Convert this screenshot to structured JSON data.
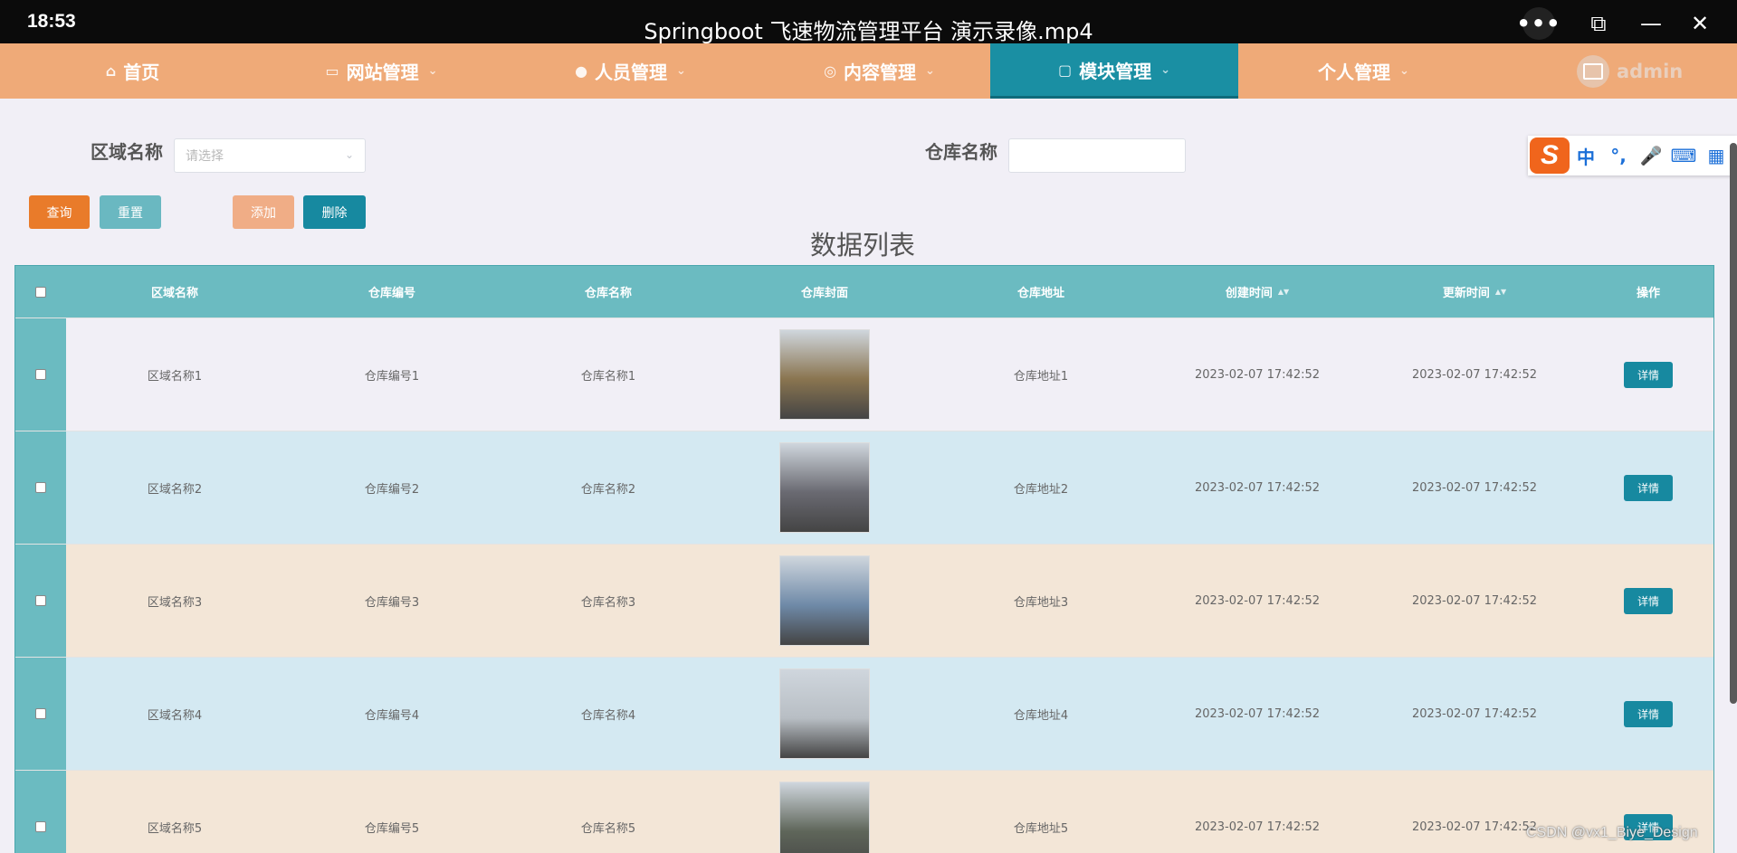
{
  "player": {
    "time": "18:53",
    "title": "Springboot 飞速物流管理平台 演示录像.mp4",
    "more": "•••",
    "pip": "⧉",
    "minimize": "—",
    "close": "✕"
  },
  "nav": {
    "items": [
      {
        "label": "首页",
        "icon": "home-icon",
        "glyph": "⌂"
      },
      {
        "label": "网站管理",
        "icon": "monitor-icon",
        "glyph": "▭"
      },
      {
        "label": "人员管理",
        "icon": "user-icon",
        "glyph": "●"
      },
      {
        "label": "内容管理",
        "icon": "circle-icon",
        "glyph": "◎"
      },
      {
        "label": "模块管理",
        "icon": "copy-icon",
        "glyph": "▢"
      },
      {
        "label": "个人管理",
        "icon": "",
        "glyph": ""
      }
    ],
    "caret": "⌄",
    "active_index": 4,
    "user": "admin"
  },
  "search": {
    "area_label": "区域名称",
    "area_placeholder": "请选择",
    "warehouse_label": "仓库名称",
    "warehouse_value": ""
  },
  "buttons": {
    "query": "查询",
    "reset": "重置",
    "add": "添加",
    "delete": "删除"
  },
  "list_title": "数据列表",
  "ime": {
    "logo": "S",
    "items": [
      "中",
      "°,",
      "🎤",
      "⌨",
      "▦"
    ]
  },
  "table": {
    "headers": [
      "区域名称",
      "仓库编号",
      "仓库名称",
      "仓库封面",
      "仓库地址",
      "创建时间",
      "更新时间",
      "操作"
    ],
    "sort_glyph": "▲▼",
    "detail_label": "详情",
    "rows": [
      {
        "area": "区域名称1",
        "code": "仓库编号1",
        "name": "仓库名称1",
        "addr": "仓库地址1",
        "created": "2023-02-07 17:42:52",
        "updated": "2023-02-07 17:42:52",
        "bg": "#f1eff6",
        "img": "#8a7550"
      },
      {
        "area": "区域名称2",
        "code": "仓库编号2",
        "name": "仓库名称2",
        "addr": "仓库地址2",
        "created": "2023-02-07 17:42:52",
        "updated": "2023-02-07 17:42:52",
        "bg": "#d4e9f2",
        "img": "#6a6a72"
      },
      {
        "area": "区域名称3",
        "code": "仓库编号3",
        "name": "仓库名称3",
        "addr": "仓库地址3",
        "created": "2023-02-07 17:42:52",
        "updated": "2023-02-07 17:42:52",
        "bg": "#f3e6d7",
        "img": "#6f8aa8"
      },
      {
        "area": "区域名称4",
        "code": "仓库编号4",
        "name": "仓库名称4",
        "addr": "仓库地址4",
        "created": "2023-02-07 17:42:52",
        "updated": "2023-02-07 17:42:52",
        "bg": "#d4e9f2",
        "img": "#b8bec4"
      },
      {
        "area": "区域名称5",
        "code": "仓库编号5",
        "name": "仓库名称5",
        "addr": "仓库地址5",
        "created": "2023-02-07 17:42:52",
        "updated": "2023-02-07 17:42:52",
        "bg": "#f3e6d7",
        "img": "#5f665a"
      }
    ]
  },
  "watermark": "CSDN @vx1_Biye_Design"
}
